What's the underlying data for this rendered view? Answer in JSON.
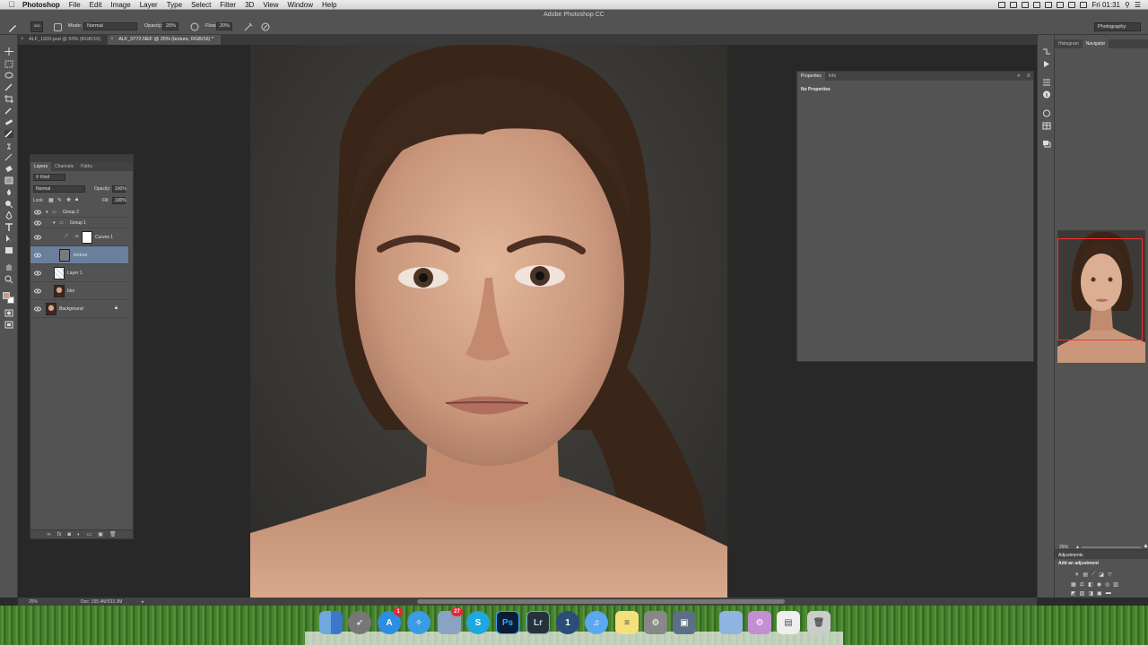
{
  "menubar": {
    "app": "Photoshop",
    "items": [
      "File",
      "Edit",
      "Image",
      "Layer",
      "Type",
      "Select",
      "Filter",
      "3D",
      "View",
      "Window",
      "Help"
    ],
    "clock": "Fri 01:31"
  },
  "options": {
    "app_title": "Adobe Photoshop CC",
    "brush_size": "300",
    "mode_label": "Mode:",
    "mode_value": "Normal",
    "opacity_label": "Opacity:",
    "opacity_value": "20%",
    "flow_label": "Flow:",
    "flow_value": "20%",
    "workspace": "Photography"
  },
  "tabs": [
    {
      "label": "ALF_1600.psd @ 50% (RGB/16)",
      "active": false
    },
    {
      "label": "ALF_0772.NEF @ 25% (texture, RGB/16) *",
      "active": true
    }
  ],
  "layers_panel": {
    "tabs": [
      "Layers",
      "Channels",
      "Paths"
    ],
    "filter_kind": "Kind",
    "blend_mode": "Normal",
    "opacity_label": "Opacity:",
    "opacity_value": "100%",
    "lock_label": "Lock:",
    "fill_label": "Fill:",
    "fill_value": "100%",
    "layers": [
      {
        "name": "Group 2",
        "type": "group",
        "indent": 0
      },
      {
        "name": "Group 1",
        "type": "group",
        "indent": 1
      },
      {
        "name": "Curves 1",
        "type": "adjustment",
        "indent": 2
      },
      {
        "name": "texture",
        "type": "pixel",
        "indent": 2,
        "selected": true
      },
      {
        "name": "Layer 1",
        "type": "pixel",
        "indent": 2
      },
      {
        "name": "blur",
        "type": "photo",
        "indent": 0
      },
      {
        "name": "Background",
        "type": "photo",
        "indent": 0,
        "locked": true
      }
    ]
  },
  "properties_panel": {
    "tabs": [
      "Properties",
      "Info"
    ],
    "empty_text": "No Properties"
  },
  "navigator": {
    "tabs": [
      "Histogram",
      "Navigator"
    ],
    "zoom": "25%"
  },
  "adjustments": {
    "tab": "Adjustments",
    "label": "Add an adjustment"
  },
  "statusbar": {
    "zoom": "25%",
    "doc": "Doc: 155.4M/533.3M"
  },
  "colors": {
    "foreground": "#c79c85",
    "background": "#ffffff",
    "selection": "#6a7f9c"
  },
  "dock": {
    "apps": [
      "Finder",
      "Launchpad",
      "App Store",
      "Safari",
      "Preview",
      "Skype",
      "Photoshop",
      "Lightroom",
      "1Password",
      "iTunes",
      "Stickies",
      "System Preferences",
      "Photo Booth",
      "Folder",
      "Archive Utility",
      "Preview Doc",
      "Trash"
    ],
    "ps_label": "Ps",
    "lr_label": "Lr",
    "skype_label": "S",
    "appstore_badge": "1",
    "safari_badge": "27"
  }
}
